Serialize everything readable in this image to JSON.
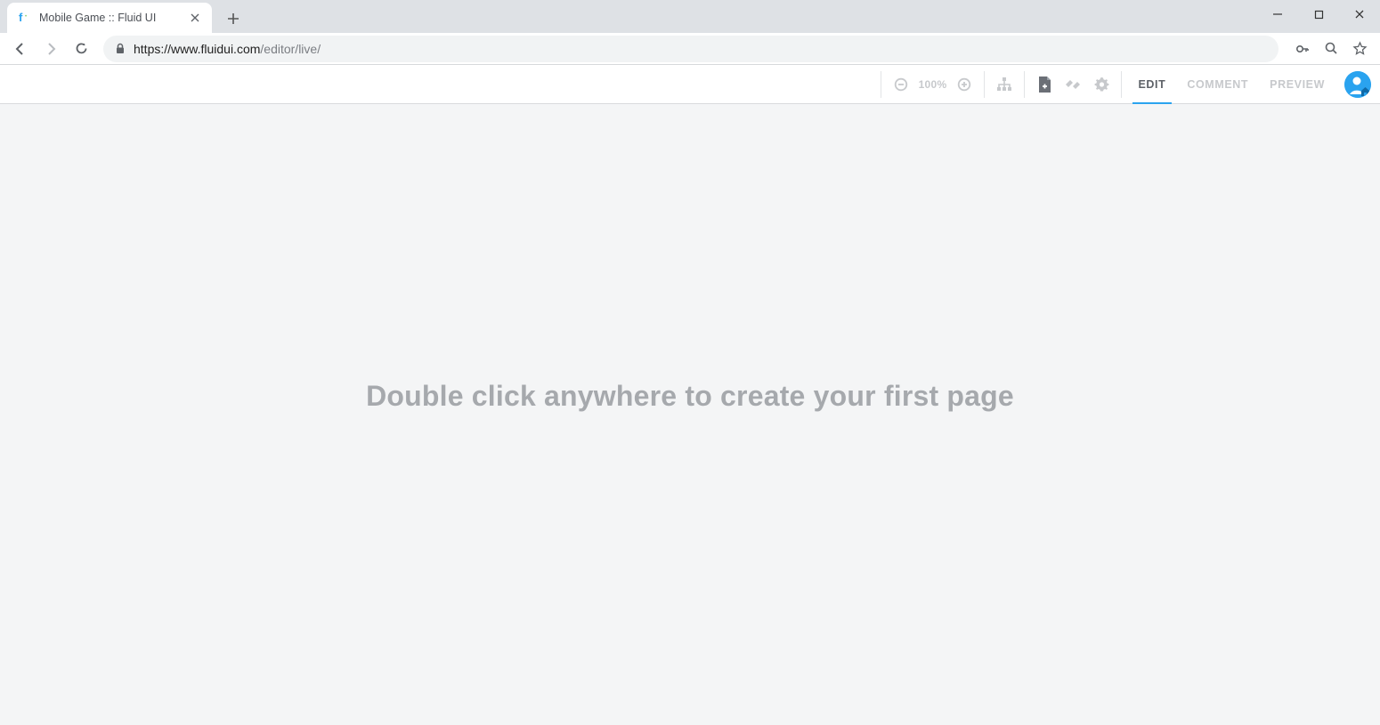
{
  "browser": {
    "tab_title": "Mobile Game :: Fluid UI",
    "url_host": "https://www.fluidui.com",
    "url_path": "/editor/live/"
  },
  "toolbar": {
    "zoom_label": "100%",
    "mode_tabs": {
      "edit": "EDIT",
      "comment": "COMMENT",
      "preview": "PREVIEW"
    },
    "icons": {
      "zoom_out": "zoom-out-icon",
      "zoom_in": "zoom-in-icon",
      "sitemap": "sitemap-icon",
      "add_page": "add-page-icon",
      "share": "link-icon",
      "settings": "gear-icon",
      "avatar": "user-home-avatar"
    }
  },
  "canvas": {
    "hint": "Double click anywhere to create your first page"
  }
}
